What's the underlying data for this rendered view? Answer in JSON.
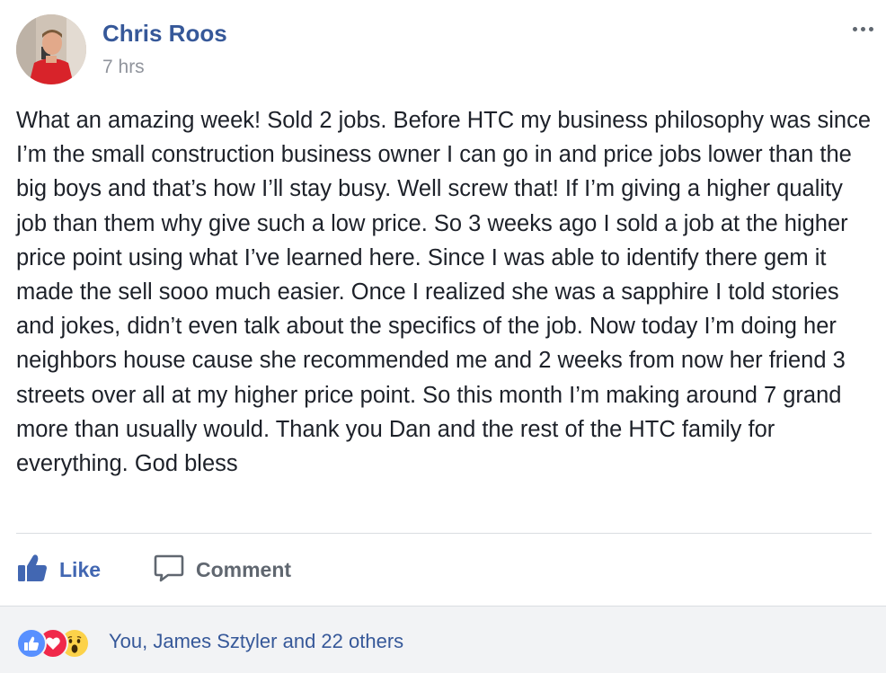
{
  "post": {
    "author": "Chris Roos",
    "timestamp": "7 hrs",
    "message": "What an amazing week! Sold 2 jobs. Before HTC my business philosophy was since I’m the small construction business owner I can go in and price jobs lower than the big boys and that’s how I’ll stay busy. Well screw that! If I’m giving a higher quality job than them why give such a low price. So 3 weeks ago I sold a job at the higher price point using what I’ve learned here. Since I was able to identify there gem it made the sell sooo much easier. Once I realized she was a sapphire I told stories and jokes, didn’t even talk about the specifics of the job. Now today I’m doing her neighbors house cause she recommended me and 2 weeks from now her friend 3 streets over all at my higher price point. So this month I’m making around 7 grand more than usually would. Thank you Dan and the rest of the HTC family for everything. God bless"
  },
  "actions": {
    "like_label": "Like",
    "comment_label": "Comment"
  },
  "reactions": {
    "summary": "You, James Sztyler and 22 others",
    "icons": [
      "like-icon",
      "love-icon",
      "wow-icon"
    ]
  },
  "colors": {
    "link_blue": "#365899",
    "like_blue": "#4267b2",
    "secondary_gray": "#90949c",
    "footer_bg": "#f2f3f5"
  }
}
